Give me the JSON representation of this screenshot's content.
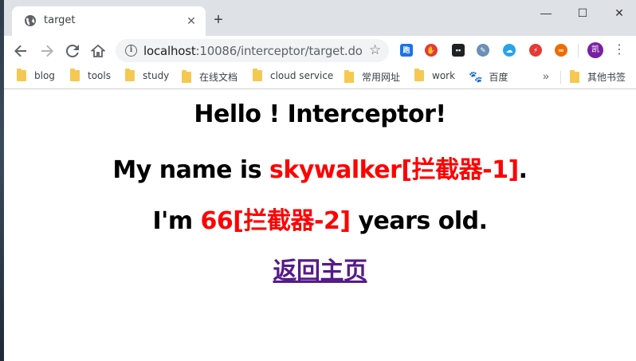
{
  "tab": {
    "title": "target"
  },
  "address_bar": {
    "host": "localhost",
    "path": ":10086/interceptor/target.do"
  },
  "bookmarks": [
    {
      "label": "blog"
    },
    {
      "label": "tools"
    },
    {
      "label": "study"
    },
    {
      "label": "在线文档"
    },
    {
      "label": "cloud service"
    },
    {
      "label": "常用网址"
    },
    {
      "label": "work"
    },
    {
      "label": "百度"
    }
  ],
  "other_bookmarks": "其他书签",
  "profile_initial": "凯",
  "page": {
    "heading": "Hello ! Interceptor!",
    "name_prefix": "My name is ",
    "name_value": "skywalker[拦截器-1]",
    "name_suffix": ".",
    "age_prefix": "I'm ",
    "age_value": "66[拦截器-2]",
    "age_suffix": " years old.",
    "back_link": "返回主页"
  },
  "colors": {
    "highlight": "#ff0000",
    "link_visited": "#551a8b",
    "tab_strip": "#dee1e6"
  },
  "icons": [
    "globe-icon",
    "back-icon",
    "forward-icon",
    "reload-icon",
    "home-icon",
    "info-icon",
    "star-icon",
    "folder-icon",
    "baidu-paw-icon"
  ]
}
